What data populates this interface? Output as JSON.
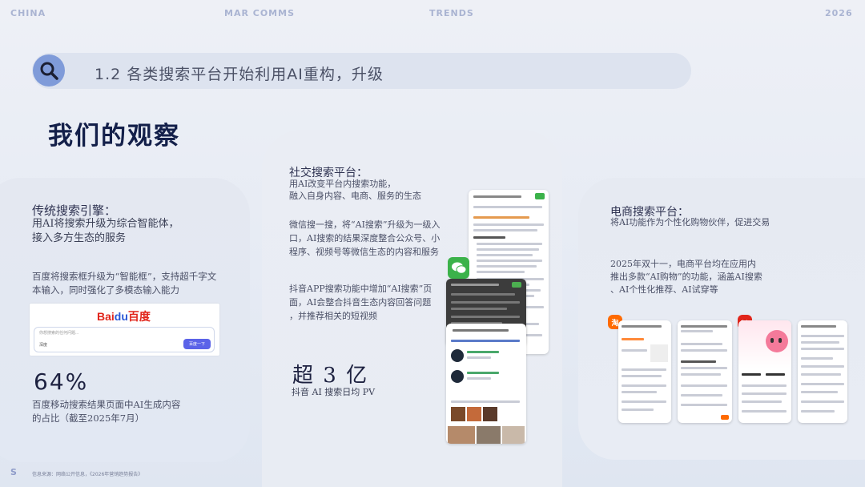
{
  "header": {
    "left": "CHINA",
    "mid1": "MAR COMMS",
    "mid2": "TRENDS",
    "right": "2026"
  },
  "section_title": "1.2 各类搜索平台开始利用AI重构，升级",
  "heading": "我们的观察",
  "left_panel": {
    "category": "传统搜索引擎：",
    "summary": [
      "用AI将搜索升级为综合智能体，",
      "接入多方生态的服务"
    ],
    "detail": [
      "百度将搜索框升级为“智能框”，支持超千字文",
      "本输入，同时强化了多模态输入能力"
    ],
    "baidu_logo_a": "Bai",
    "baidu_logo_b": "du",
    "baidu_logo_c": "百度",
    "baidu_placeholder": "你想搜索的任何问题...",
    "baidu_mode": "深度",
    "baidu_button": "百度一下",
    "stat": "64%",
    "stat_caption": [
      "百度移动搜索结果页面中AI生成内容",
      "的占比（截至2025年7月）"
    ]
  },
  "mid_panel": {
    "category": "社交搜索平台：",
    "summary": [
      "用AI改变平台内搜索功能，",
      "融入自身内容、电商、服务的生态"
    ],
    "wechat": [
      "微信搜一搜，将“AI搜索”升级为一级入",
      "口，AI搜索的结果深度整合公众号、小",
      "程序、视频号等微信生态的内容和服务"
    ],
    "douyin": [
      "抖音APP搜索功能中增加“AI搜索”页",
      "面，AI会整合抖音生态内容回答问题",
      "，并推荐相关的短视频"
    ],
    "stat": "超 3 亿",
    "stat_caption": "抖音 AI 搜索日均 PV"
  },
  "right_panel": {
    "category": "电商搜索平台：",
    "summary": "将AI功能作为个性化购物伙伴，促进交易",
    "detail": [
      "2025年双十一，电商平台均在应用内",
      "推出多款“AI购物”的功能，涵盖AI搜索",
      "、AI个性化推荐、AI试穿等"
    ],
    "taobao_icon": "淘",
    "jd_icon": "京东"
  },
  "footer": {
    "mark": "S",
    "note": "信息来源：网络公开信息，《2026年营销趋势报告》"
  },
  "colors": {
    "accent": "#7f9bd9",
    "heading": "#14204a",
    "baidu_red": "#e1251b",
    "baidu_blue": "#2b57d6",
    "wechat_green": "#3bb24a",
    "taobao_orange": "#ff6a00",
    "jd_red": "#e1251b"
  },
  "icons": [
    "search-icon",
    "wechat-icon",
    "taobao-icon",
    "jd-icon"
  ]
}
